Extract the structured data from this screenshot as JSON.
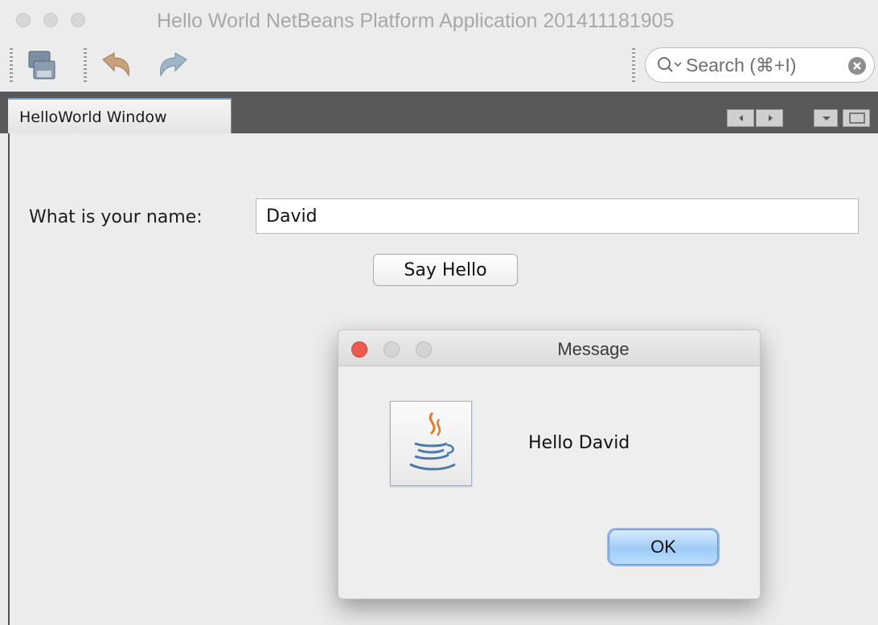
{
  "window": {
    "title": "Hello World NetBeans Platform Application 201411181905"
  },
  "toolbar": {
    "icons": [
      "save-all-icon",
      "undo-icon",
      "redo-icon"
    ],
    "search_placeholder": "Search (⌘+I)"
  },
  "tabs": [
    {
      "label": "HelloWorld Window"
    }
  ],
  "form": {
    "name_label": "What is your name:",
    "name_value": "David",
    "say_button": "Say Hello"
  },
  "dialog": {
    "title": "Message",
    "message": "Hello David",
    "ok_label": "OK",
    "icon": "java-icon"
  },
  "colors": {
    "tab_strip": "#595959",
    "close_red": "#ed5a50",
    "ok_blue": "#9fcbf6"
  }
}
